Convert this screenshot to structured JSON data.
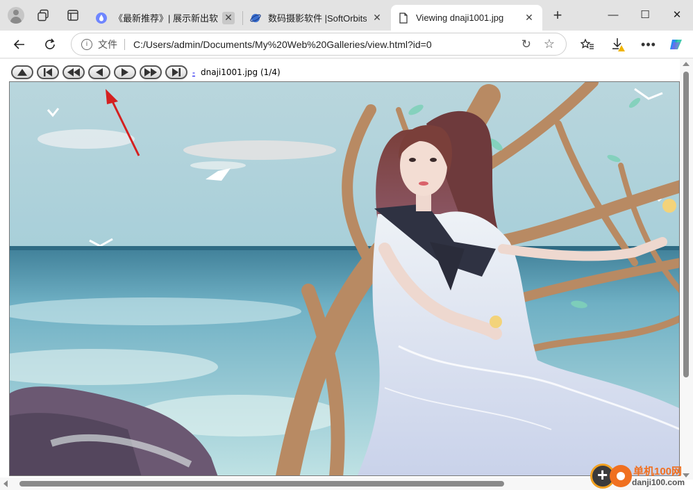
{
  "tabs": [
    {
      "title": "《最新推荐》| 展示新出软件",
      "favicon": "drop-icon"
    },
    {
      "title": "数码摄影软件 |SoftOrbits 软件",
      "favicon": "softorbits-icon"
    },
    {
      "title": "Viewing dnaji1001.jpg",
      "favicon": "page-icon"
    }
  ],
  "toolbar": {
    "address_prefix": "文件",
    "url": "C:/Users/admin/Documents/My%20Web%20Galleries/view.html?id=0"
  },
  "gallery": {
    "nav_buttons": [
      "up",
      "first",
      "rewind",
      "previous",
      "play",
      "fast-forward",
      "last"
    ],
    "link_text": "-",
    "caption": "dnaji1001.jpg (1/4)"
  },
  "watermark": {
    "text1": "单机100网",
    "text2": "danji100.com"
  },
  "colors": {
    "accent_red": "#d42020",
    "tab_strip": "#e3e3e3"
  }
}
